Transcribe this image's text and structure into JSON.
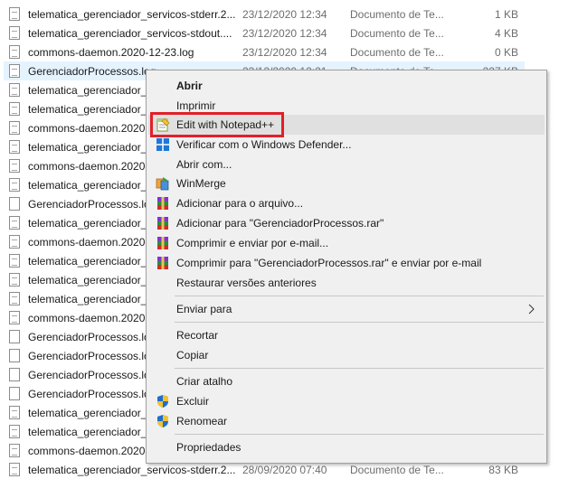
{
  "files": [
    {
      "name": "telematica_gerenciador_servicos-stderr.2...",
      "date": "23/12/2020 12:34",
      "type": "Documento de Te...",
      "size": "1 KB",
      "icon": "text-file-icon"
    },
    {
      "name": "telematica_gerenciador_servicos-stdout....",
      "date": "23/12/2020 12:34",
      "type": "Documento de Te...",
      "size": "4 KB",
      "icon": "text-file-icon"
    },
    {
      "name": "commons-daemon.2020-12-23.log",
      "date": "23/12/2020 12:34",
      "type": "Documento de Te...",
      "size": "0 KB",
      "icon": "text-file-icon"
    },
    {
      "name": "GerenciadorProcessos.log",
      "date": "23/12/2020 12:21",
      "type": "Documento de Te...",
      "size": "227 KB",
      "icon": "text-file-icon"
    },
    {
      "name": "telematica_gerenciador_s",
      "date": "",
      "type": "",
      "size": "",
      "icon": "text-file-icon"
    },
    {
      "name": "telematica_gerenciador_s",
      "date": "",
      "type": "",
      "size": "",
      "icon": "text-file-icon"
    },
    {
      "name": "commons-daemon.2020-",
      "date": "",
      "type": "",
      "size": "",
      "icon": "text-file-icon"
    },
    {
      "name": "telematica_gerenciador_s",
      "date": "",
      "type": "",
      "size": "",
      "icon": "text-file-icon"
    },
    {
      "name": "commons-daemon.2020-",
      "date": "",
      "type": "",
      "size": "",
      "icon": "text-file-icon"
    },
    {
      "name": "telematica_gerenciador_s",
      "date": "",
      "type": "",
      "size": "",
      "icon": "text-file-icon"
    },
    {
      "name": "GerenciadorProcessos.log",
      "date": "",
      "type": "",
      "size": "",
      "icon": "blank-file-icon"
    },
    {
      "name": "telematica_gerenciador_s",
      "date": "",
      "type": "",
      "size": "",
      "icon": "text-file-icon"
    },
    {
      "name": "commons-daemon.2020-",
      "date": "",
      "type": "",
      "size": "",
      "icon": "text-file-icon"
    },
    {
      "name": "telematica_gerenciador_s",
      "date": "",
      "type": "",
      "size": "",
      "icon": "text-file-icon"
    },
    {
      "name": "telematica_gerenciador_s",
      "date": "",
      "type": "",
      "size": "",
      "icon": "text-file-icon"
    },
    {
      "name": "telematica_gerenciador_s",
      "date": "",
      "type": "",
      "size": "",
      "icon": "text-file-icon"
    },
    {
      "name": "commons-daemon.2020-",
      "date": "",
      "type": "",
      "size": "",
      "icon": "text-file-icon"
    },
    {
      "name": "GerenciadorProcessos.log",
      "date": "",
      "type": "",
      "size": "",
      "icon": "blank-file-icon"
    },
    {
      "name": "GerenciadorProcessos.log",
      "date": "",
      "type": "",
      "size": "",
      "icon": "blank-file-icon"
    },
    {
      "name": "GerenciadorProcessos.log",
      "date": "",
      "type": "",
      "size": "",
      "icon": "blank-file-icon"
    },
    {
      "name": "GerenciadorProcessos.log",
      "date": "",
      "type": "",
      "size": "",
      "icon": "blank-file-icon"
    },
    {
      "name": "telematica_gerenciador_s",
      "date": "",
      "type": "",
      "size": "",
      "icon": "text-file-icon"
    },
    {
      "name": "telematica_gerenciador_s",
      "date": "",
      "type": "",
      "size": "",
      "icon": "text-file-icon"
    },
    {
      "name": "commons-daemon.2020-",
      "date": "",
      "type": "",
      "size": "",
      "icon": "text-file-icon"
    },
    {
      "name": "telematica_gerenciador_servicos-stderr.2...",
      "date": "28/09/2020 07:40",
      "type": "Documento de Te...",
      "size": "83 KB",
      "icon": "text-file-icon"
    }
  ],
  "context_menu": {
    "open": "Abrir",
    "print": "Imprimir",
    "edit_notepadpp": "Edit with Notepad++",
    "defender": "Verificar com o Windows Defender...",
    "open_with": "Abrir com...",
    "winmerge": "WinMerge",
    "add_archive": "Adicionar para o arquivo...",
    "add_rar": "Adicionar para \"GerenciadorProcessos.rar\"",
    "compress_email": "Comprimir e enviar por e-mail...",
    "compress_rar_email": "Comprimir para \"GerenciadorProcessos.rar\" e enviar por e-mail",
    "restore_versions": "Restaurar versões anteriores",
    "send_to": "Enviar para",
    "cut": "Recortar",
    "copy": "Copiar",
    "create_shortcut": "Criar atalho",
    "delete": "Excluir",
    "rename": "Renomear",
    "properties": "Propriedades"
  },
  "colors": {
    "highlight": "#e0202a",
    "selection": "#e5f3ff",
    "menu_bg": "#f0f0f0"
  }
}
